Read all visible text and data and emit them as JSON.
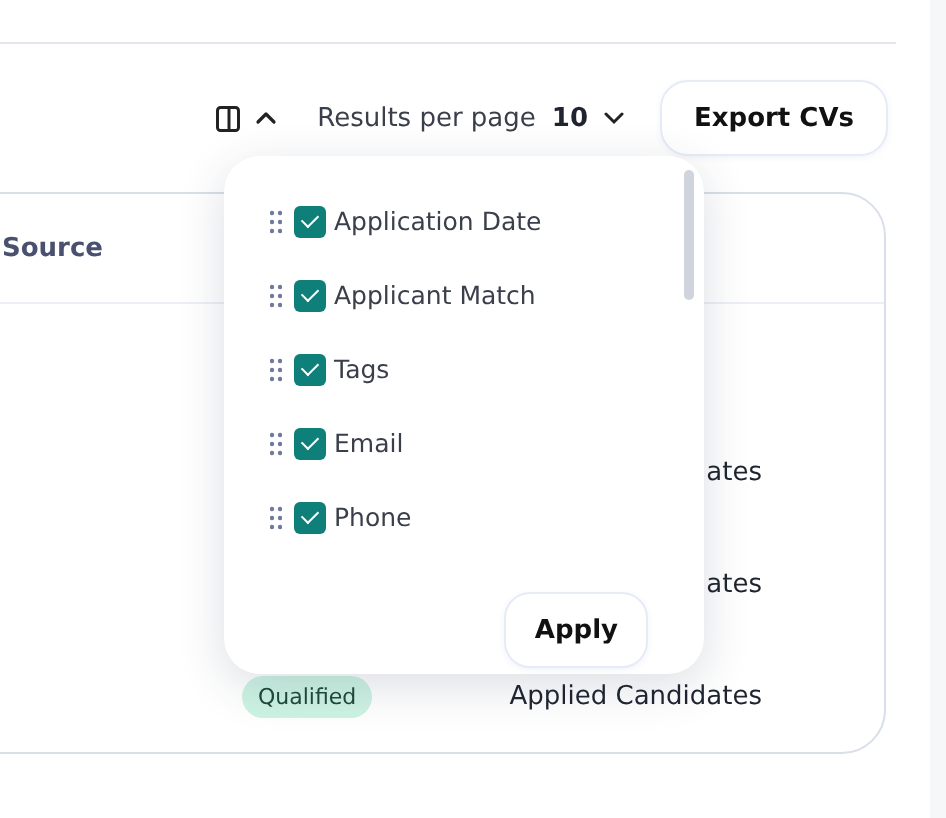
{
  "toolbar": {
    "columns_menu_open": true,
    "results_label": "Results per page",
    "results_value": "10",
    "export_button": "Export CVs"
  },
  "column_menu": {
    "items": [
      {
        "label": "Application Date",
        "checked": true
      },
      {
        "label": "Applicant Match",
        "checked": true
      },
      {
        "label": "Tags",
        "checked": true
      },
      {
        "label": "Email",
        "checked": true
      },
      {
        "label": "Phone",
        "checked": true
      }
    ],
    "apply_button": "Apply"
  },
  "table": {
    "columns": [
      "Source"
    ],
    "rows": [
      {
        "column_3": "ates"
      },
      {
        "column_3": "ates"
      },
      {
        "tag": "Qualified",
        "column_3": "Applied Candidates"
      }
    ]
  }
}
